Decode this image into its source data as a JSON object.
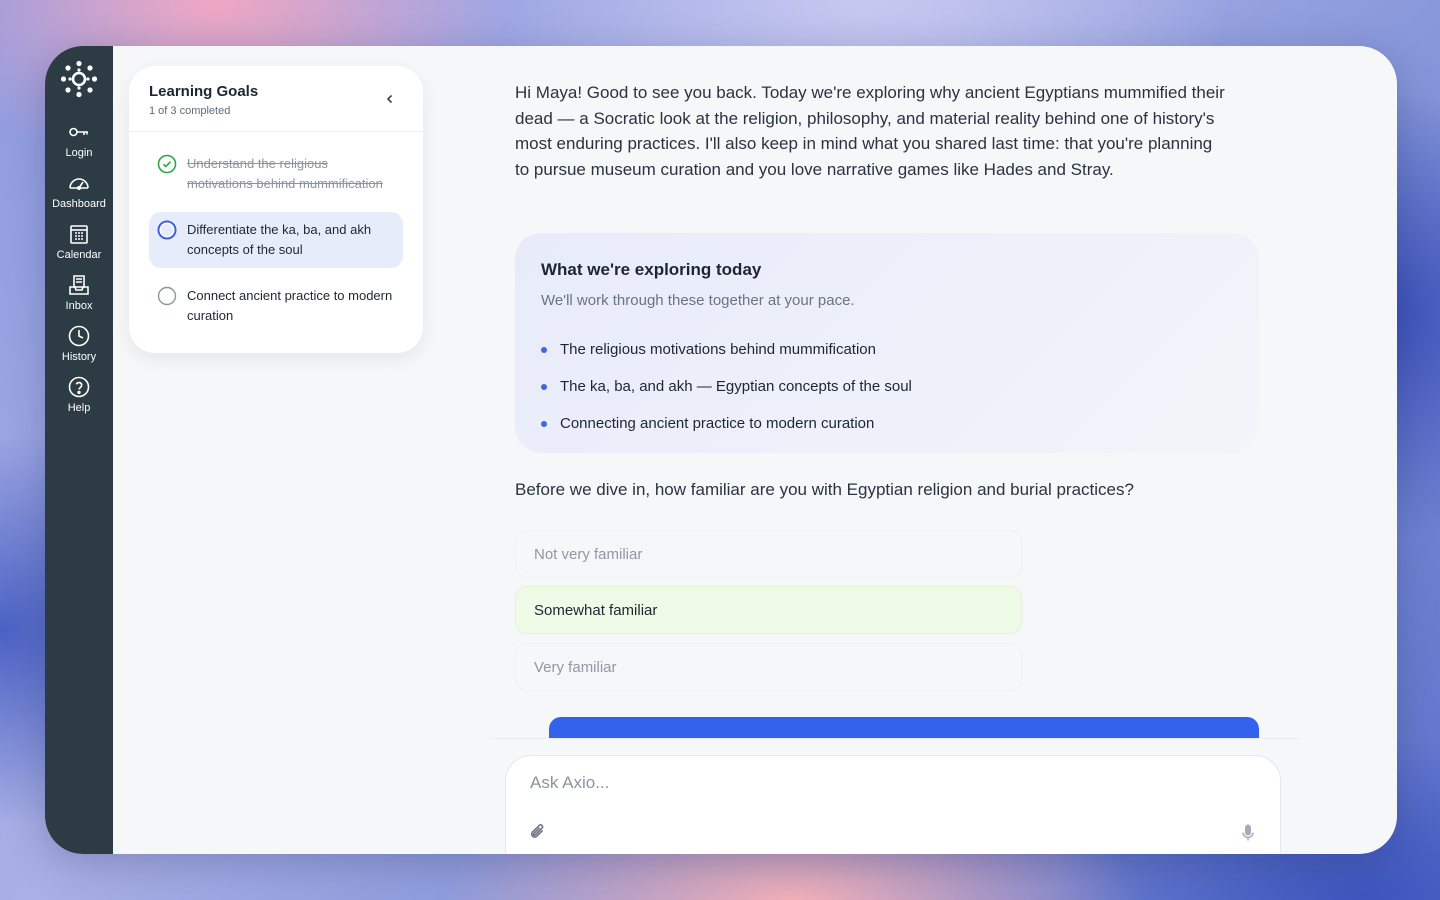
{
  "nav": {
    "logo_icon": "canvas-logo-icon",
    "items": [
      {
        "label": "Login",
        "icon": "key-icon"
      },
      {
        "label": "Dashboard",
        "icon": "dashboard-icon"
      },
      {
        "label": "Calendar",
        "icon": "calendar-icon"
      },
      {
        "label": "Inbox",
        "icon": "inbox-icon"
      },
      {
        "label": "History",
        "icon": "clock-icon"
      },
      {
        "label": "Help",
        "icon": "help-icon"
      }
    ]
  },
  "goals": {
    "title": "Learning Goals",
    "progress": "1 of 3 completed",
    "items": [
      {
        "text": "Understand the religious motivations behind mummification",
        "status": "done"
      },
      {
        "text": "Differentiate the ka, ba, and akh concepts of the soul",
        "status": "active"
      },
      {
        "text": "Connect ancient practice to modern curation",
        "status": "todo"
      }
    ]
  },
  "chat": {
    "intro": "Hi Maya! Good to see you back. Today we're exploring why ancient Egyptians mummified their dead — a Socratic look at the religion, philosophy, and material reality behind one of history's most enduring practices. I'll also keep in mind what you shared last time: that you're planning to pursue museum curation and you love narrative games like Hades and Stray.",
    "explore": {
      "title": "What we're exploring today",
      "subtitle": "We'll work through these together at your pace.",
      "items": [
        "The religious motivations behind mummification",
        "The ka, ba, and akh — Egyptian concepts of the soul",
        "Connecting ancient practice to modern curation"
      ]
    },
    "question": "Before we dive in, how familiar are you with Egyptian religion and burial practices?",
    "options": [
      {
        "label": "Not very familiar",
        "selected": false
      },
      {
        "label": "Somewhat familiar",
        "selected": true
      },
      {
        "label": "Very familiar",
        "selected": false
      }
    ]
  },
  "input": {
    "placeholder": "Ask Axio...",
    "attach_icon": "paperclip-icon",
    "mic_icon": "microphone-icon"
  },
  "colors": {
    "rail": "#2c3b44",
    "accent": "#3462ec",
    "success": "#2aa84a",
    "selected_option": "#eefbe6"
  }
}
